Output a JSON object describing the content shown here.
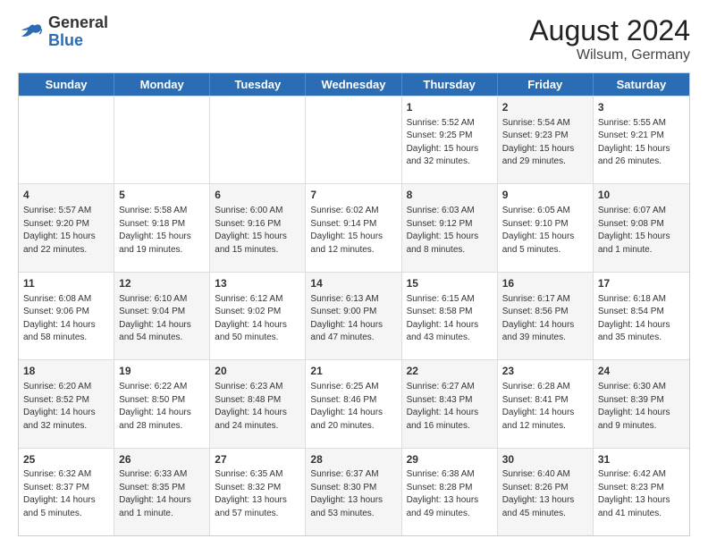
{
  "header": {
    "logo": {
      "general": "General",
      "blue": "Blue"
    },
    "title": "August 2024",
    "subtitle": "Wilsum, Germany"
  },
  "calendar": {
    "days": [
      "Sunday",
      "Monday",
      "Tuesday",
      "Wednesday",
      "Thursday",
      "Friday",
      "Saturday"
    ],
    "rows": [
      [
        {
          "day": "",
          "text": "",
          "shaded": false
        },
        {
          "day": "",
          "text": "",
          "shaded": false
        },
        {
          "day": "",
          "text": "",
          "shaded": false
        },
        {
          "day": "",
          "text": "",
          "shaded": false
        },
        {
          "day": "1",
          "text": "Sunrise: 5:52 AM\nSunset: 9:25 PM\nDaylight: 15 hours\nand 32 minutes.",
          "shaded": false
        },
        {
          "day": "2",
          "text": "Sunrise: 5:54 AM\nSunset: 9:23 PM\nDaylight: 15 hours\nand 29 minutes.",
          "shaded": true
        },
        {
          "day": "3",
          "text": "Sunrise: 5:55 AM\nSunset: 9:21 PM\nDaylight: 15 hours\nand 26 minutes.",
          "shaded": false
        }
      ],
      [
        {
          "day": "4",
          "text": "Sunrise: 5:57 AM\nSunset: 9:20 PM\nDaylight: 15 hours\nand 22 minutes.",
          "shaded": true
        },
        {
          "day": "5",
          "text": "Sunrise: 5:58 AM\nSunset: 9:18 PM\nDaylight: 15 hours\nand 19 minutes.",
          "shaded": false
        },
        {
          "day": "6",
          "text": "Sunrise: 6:00 AM\nSunset: 9:16 PM\nDaylight: 15 hours\nand 15 minutes.",
          "shaded": true
        },
        {
          "day": "7",
          "text": "Sunrise: 6:02 AM\nSunset: 9:14 PM\nDaylight: 15 hours\nand 12 minutes.",
          "shaded": false
        },
        {
          "day": "8",
          "text": "Sunrise: 6:03 AM\nSunset: 9:12 PM\nDaylight: 15 hours\nand 8 minutes.",
          "shaded": true
        },
        {
          "day": "9",
          "text": "Sunrise: 6:05 AM\nSunset: 9:10 PM\nDaylight: 15 hours\nand 5 minutes.",
          "shaded": false
        },
        {
          "day": "10",
          "text": "Sunrise: 6:07 AM\nSunset: 9:08 PM\nDaylight: 15 hours\nand 1 minute.",
          "shaded": true
        }
      ],
      [
        {
          "day": "11",
          "text": "Sunrise: 6:08 AM\nSunset: 9:06 PM\nDaylight: 14 hours\nand 58 minutes.",
          "shaded": false
        },
        {
          "day": "12",
          "text": "Sunrise: 6:10 AM\nSunset: 9:04 PM\nDaylight: 14 hours\nand 54 minutes.",
          "shaded": true
        },
        {
          "day": "13",
          "text": "Sunrise: 6:12 AM\nSunset: 9:02 PM\nDaylight: 14 hours\nand 50 minutes.",
          "shaded": false
        },
        {
          "day": "14",
          "text": "Sunrise: 6:13 AM\nSunset: 9:00 PM\nDaylight: 14 hours\nand 47 minutes.",
          "shaded": true
        },
        {
          "day": "15",
          "text": "Sunrise: 6:15 AM\nSunset: 8:58 PM\nDaylight: 14 hours\nand 43 minutes.",
          "shaded": false
        },
        {
          "day": "16",
          "text": "Sunrise: 6:17 AM\nSunset: 8:56 PM\nDaylight: 14 hours\nand 39 minutes.",
          "shaded": true
        },
        {
          "day": "17",
          "text": "Sunrise: 6:18 AM\nSunset: 8:54 PM\nDaylight: 14 hours\nand 35 minutes.",
          "shaded": false
        }
      ],
      [
        {
          "day": "18",
          "text": "Sunrise: 6:20 AM\nSunset: 8:52 PM\nDaylight: 14 hours\nand 32 minutes.",
          "shaded": true
        },
        {
          "day": "19",
          "text": "Sunrise: 6:22 AM\nSunset: 8:50 PM\nDaylight: 14 hours\nand 28 minutes.",
          "shaded": false
        },
        {
          "day": "20",
          "text": "Sunrise: 6:23 AM\nSunset: 8:48 PM\nDaylight: 14 hours\nand 24 minutes.",
          "shaded": true
        },
        {
          "day": "21",
          "text": "Sunrise: 6:25 AM\nSunset: 8:46 PM\nDaylight: 14 hours\nand 20 minutes.",
          "shaded": false
        },
        {
          "day": "22",
          "text": "Sunrise: 6:27 AM\nSunset: 8:43 PM\nDaylight: 14 hours\nand 16 minutes.",
          "shaded": true
        },
        {
          "day": "23",
          "text": "Sunrise: 6:28 AM\nSunset: 8:41 PM\nDaylight: 14 hours\nand 12 minutes.",
          "shaded": false
        },
        {
          "day": "24",
          "text": "Sunrise: 6:30 AM\nSunset: 8:39 PM\nDaylight: 14 hours\nand 9 minutes.",
          "shaded": true
        }
      ],
      [
        {
          "day": "25",
          "text": "Sunrise: 6:32 AM\nSunset: 8:37 PM\nDaylight: 14 hours\nand 5 minutes.",
          "shaded": false
        },
        {
          "day": "26",
          "text": "Sunrise: 6:33 AM\nSunset: 8:35 PM\nDaylight: 14 hours\nand 1 minute.",
          "shaded": true
        },
        {
          "day": "27",
          "text": "Sunrise: 6:35 AM\nSunset: 8:32 PM\nDaylight: 13 hours\nand 57 minutes.",
          "shaded": false
        },
        {
          "day": "28",
          "text": "Sunrise: 6:37 AM\nSunset: 8:30 PM\nDaylight: 13 hours\nand 53 minutes.",
          "shaded": true
        },
        {
          "day": "29",
          "text": "Sunrise: 6:38 AM\nSunset: 8:28 PM\nDaylight: 13 hours\nand 49 minutes.",
          "shaded": false
        },
        {
          "day": "30",
          "text": "Sunrise: 6:40 AM\nSunset: 8:26 PM\nDaylight: 13 hours\nand 45 minutes.",
          "shaded": true
        },
        {
          "day": "31",
          "text": "Sunrise: 6:42 AM\nSunset: 8:23 PM\nDaylight: 13 hours\nand 41 minutes.",
          "shaded": false
        }
      ]
    ]
  }
}
